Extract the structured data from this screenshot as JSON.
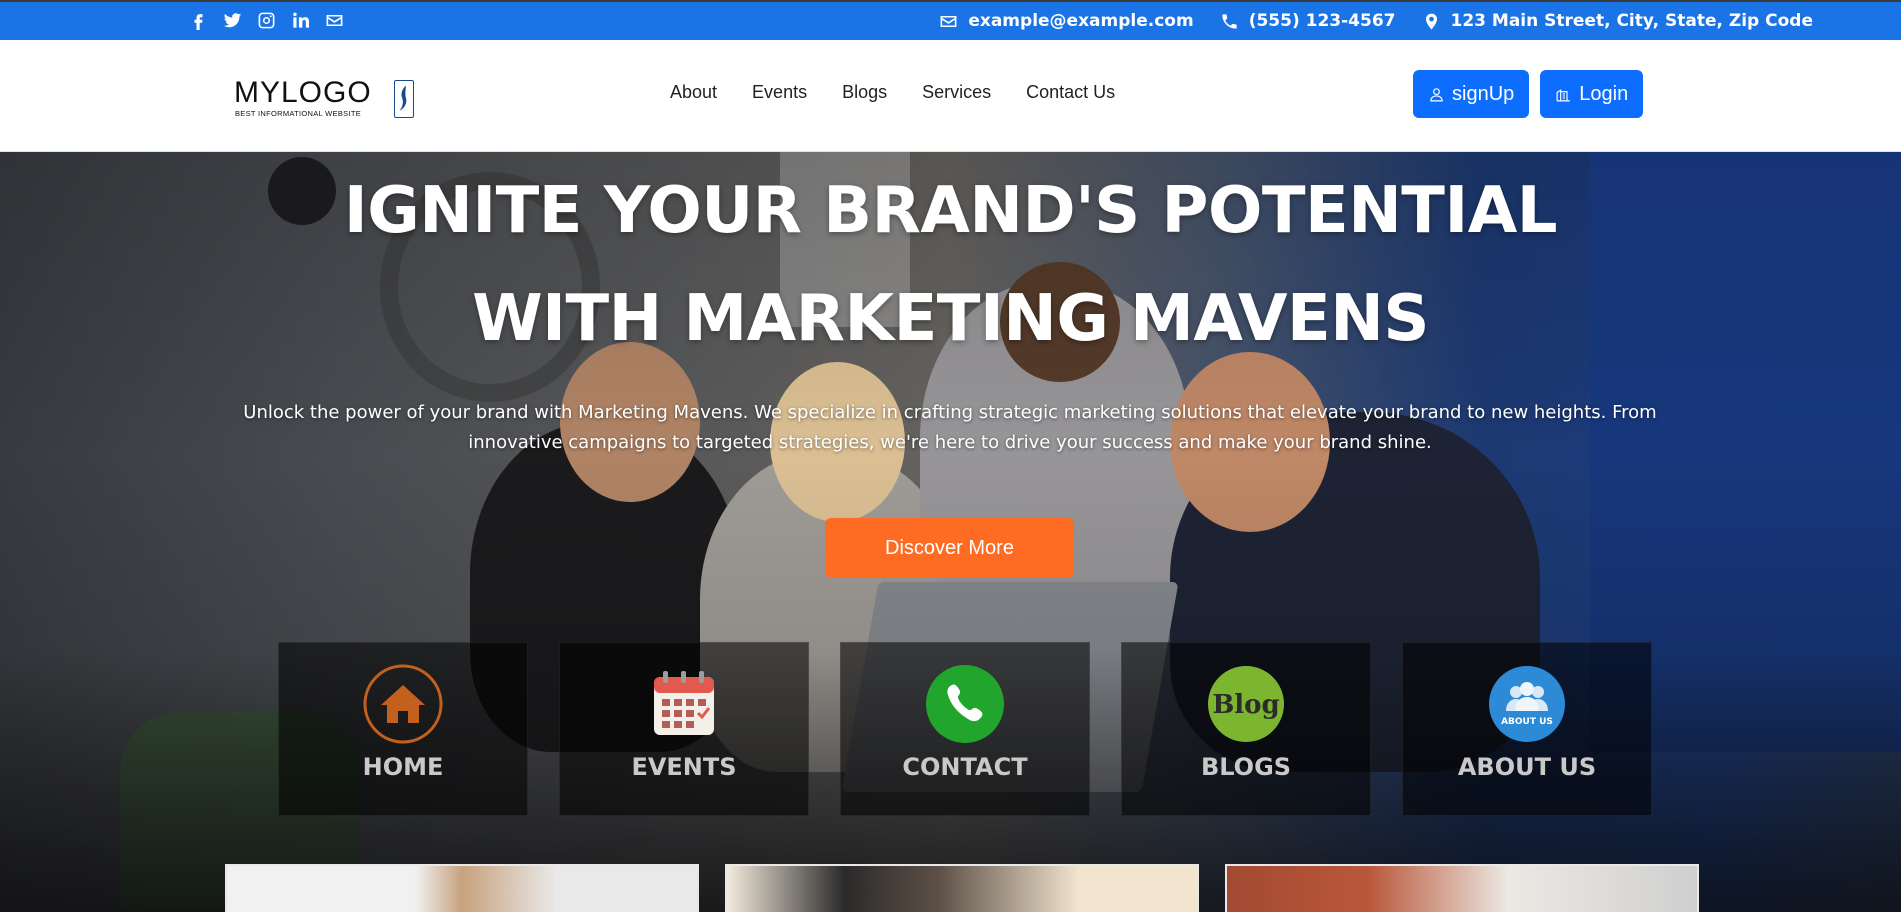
{
  "topbar": {
    "social_icons": [
      "facebook-icon",
      "twitter-icon",
      "instagram-icon",
      "linkedin-icon",
      "envelope-icon"
    ],
    "email": "example@example.com",
    "phone": "(555) 123-4567",
    "address": "123 Main Street, City, State, Zip Code",
    "background": "#1b74e6"
  },
  "navbar": {
    "logo_text": "MYLOGO",
    "logo_tagline": "BEST INFORMATIONAL WEBSITE",
    "menu": [
      "About",
      "Events",
      "Blogs",
      "Services",
      "Contact Us"
    ],
    "signup_label": "signUp",
    "login_label": "Login",
    "button_color": "#0d6efd"
  },
  "hero": {
    "title_line1": "IGNITE YOUR BRAND'S POTENTIAL",
    "title_line2": "WITH MARKETING MAVENS",
    "lead": "Unlock the power of your brand with Marketing Mavens. We specialize in crafting strategic marketing solutions that elevate your brand to new heights. From innovative campaigns to targeted strategies, we're here to drive your success and make your brand shine.",
    "cta_label": "Discover More",
    "cta_color": "#fd6c22",
    "tiles": [
      {
        "label": "HOME",
        "icon": "home-icon"
      },
      {
        "label": "EVENTS",
        "icon": "calendar-icon"
      },
      {
        "label": "CONTACT",
        "icon": "phone-icon"
      },
      {
        "label": "BLOGS",
        "icon": "blog-icon",
        "icon_text": "Blog"
      },
      {
        "label": "ABOUT US",
        "icon": "about-us-icon",
        "icon_text": "ABOUT US"
      }
    ]
  }
}
